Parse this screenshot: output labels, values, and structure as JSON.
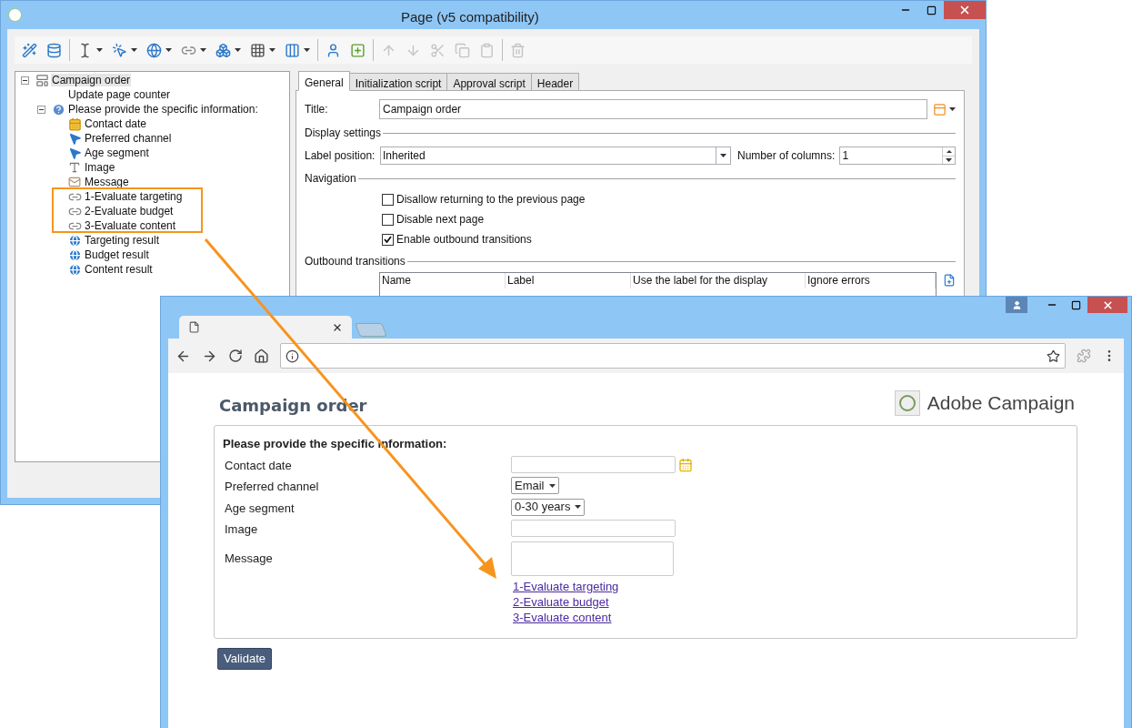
{
  "editor": {
    "title": "Page (v5 compatibility)",
    "toolbar": [
      {
        "kind": "wand",
        "dropdown": false,
        "disabled": false
      },
      {
        "kind": "database",
        "dropdown": false,
        "disabled": false
      },
      {
        "kind": "separator"
      },
      {
        "kind": "cursor",
        "dropdown": true,
        "disabled": false
      },
      {
        "kind": "pointer",
        "dropdown": true,
        "disabled": false
      },
      {
        "kind": "globe",
        "dropdown": true,
        "disabled": false
      },
      {
        "kind": "link",
        "dropdown": true,
        "disabled": false
      },
      {
        "kind": "boxes",
        "dropdown": true,
        "disabled": false
      },
      {
        "kind": "grid",
        "dropdown": true,
        "disabled": false
      },
      {
        "kind": "columns",
        "dropdown": true,
        "disabled": false
      },
      {
        "kind": "separator"
      },
      {
        "kind": "user",
        "dropdown": false,
        "disabled": false
      },
      {
        "kind": "add",
        "dropdown": false,
        "disabled": false
      },
      {
        "kind": "separator"
      },
      {
        "kind": "up",
        "dropdown": false,
        "disabled": true
      },
      {
        "kind": "down",
        "dropdown": false,
        "disabled": true
      },
      {
        "kind": "cut",
        "dropdown": false,
        "disabled": true
      },
      {
        "kind": "copy",
        "dropdown": false,
        "disabled": true
      },
      {
        "kind": "paste",
        "dropdown": false,
        "disabled": true
      },
      {
        "kind": "separator"
      },
      {
        "kind": "delete",
        "dropdown": false,
        "disabled": true
      }
    ],
    "tree": [
      {
        "label": "Campaign order",
        "kind": "page",
        "selected": true,
        "expanded": true,
        "children": [
          {
            "label": "Update page counter",
            "kind": "none",
            "selected": false
          },
          {
            "label": "Please provide the specific information:",
            "kind": "question",
            "selected": false,
            "expanded": true,
            "children": [
              {
                "label": "Contact date",
                "kind": "date",
                "selected": false
              },
              {
                "label": "Preferred channel",
                "kind": "select",
                "selected": false
              },
              {
                "label": "Age segment",
                "kind": "select",
                "selected": false
              },
              {
                "label": "Image",
                "kind": "text",
                "selected": false
              },
              {
                "label": "Message",
                "kind": "message",
                "selected": false
              },
              {
                "label": "1-Evaluate targeting",
                "kind": "link",
                "selected": false
              },
              {
                "label": "2-Evaluate budget",
                "kind": "link",
                "selected": false
              },
              {
                "label": "3-Evaluate content",
                "kind": "link",
                "selected": false
              },
              {
                "label": "Targeting result",
                "kind": "globe",
                "selected": false
              },
              {
                "label": "Budget result",
                "kind": "globe",
                "selected": false
              },
              {
                "label": "Content result",
                "kind": "globe",
                "selected": false
              }
            ]
          }
        ]
      }
    ],
    "tabs": [
      {
        "label": "General",
        "selected": true
      },
      {
        "label": "Initialization script",
        "selected": false
      },
      {
        "label": "Approval script",
        "selected": false
      },
      {
        "label": "Header",
        "selected": false
      }
    ],
    "form": {
      "title_label": "Title:",
      "title_value": "Campaign order",
      "display_heading": "Display settings",
      "label_position_label": "Label position:",
      "label_position_value": "Inherited",
      "columns_label": "Number of columns:",
      "columns_value": "1",
      "navigation_heading": "Navigation",
      "options": [
        {
          "label": "Disallow returning to the previous page",
          "checked": false
        },
        {
          "label": "Disable next page",
          "checked": false
        },
        {
          "label": "Enable outbound transitions",
          "checked": true
        }
      ],
      "outbound_heading": "Outbound transitions",
      "table_columns": [
        "Name",
        "Label",
        "Use the label for the display",
        "Ignore errors"
      ]
    }
  },
  "browser": {
    "page_title": "Campaign order",
    "logo_text": "Adobe Campaign",
    "form_heading": "Please provide the specific information:",
    "fields": [
      {
        "kind": "date",
        "label": "Contact date"
      },
      {
        "kind": "select",
        "label": "Preferred channel",
        "value": "Email"
      },
      {
        "kind": "select",
        "label": "Age segment",
        "value": "0-30 years"
      },
      {
        "kind": "text",
        "label": "Image"
      },
      {
        "kind": "textarea",
        "label": "Message"
      }
    ],
    "links": [
      "1-Evaluate targeting",
      "2-Evaluate budget",
      "3-Evaluate content"
    ],
    "button": "Validate"
  }
}
